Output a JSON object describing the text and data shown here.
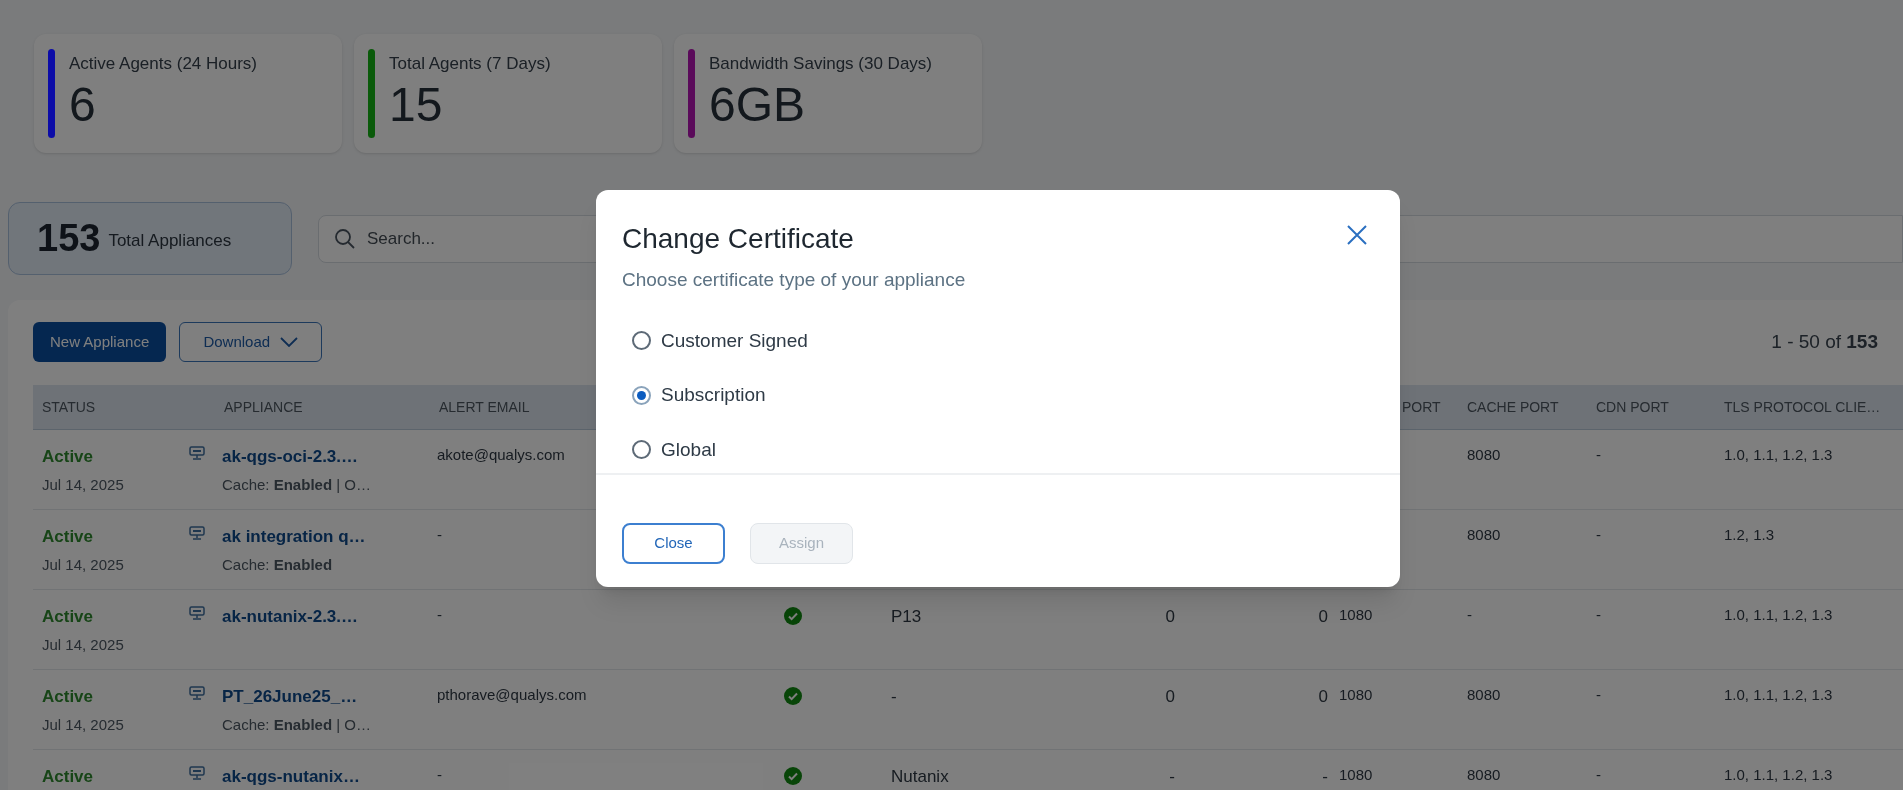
{
  "stats": [
    {
      "label": "Active Agents (24 Hours)",
      "value": "6",
      "color": "#0c0ca8"
    },
    {
      "label": "Total Agents (7 Days)",
      "value": "15",
      "color": "#0a5a0a"
    },
    {
      "label": "Bandwidth Savings (30 Days)",
      "value": "6GB",
      "color": "#5a0a5a"
    }
  ],
  "appliance_total": {
    "count": "153",
    "label": "Total Appliances"
  },
  "search": {
    "placeholder": "Search..."
  },
  "toolbar": {
    "buttons": [
      {
        "label": "New Appliance",
        "kind": "primary"
      },
      {
        "label": "Download",
        "kind": "dropdown"
      }
    ],
    "pagination": "1 - 50 of **153**"
  },
  "table": {
    "columns": {
      "status": "STATUS",
      "appliance": "APPLIANCE",
      "alert_email": "ALERT EMAIL",
      "column_9": "PORT",
      "cache_port": "CACHE PORT",
      "cdn_port": "CDN PORT",
      "tls_protocol": "TLS PROTOCOL CLIE…"
    },
    "rows": [
      {
        "status": "Active",
        "date": "Jul 14, 2025",
        "appliance": "ak-qgs-oci-2.3.…",
        "details": "Cache: **Enabled** | O…",
        "alert_email": "akote@qualys.com",
        "cache_port": "8080",
        "cdn_port": "-",
        "tls_protocol": "1.0, 1.1, 1.2, 1.3"
      },
      {
        "status": "Active",
        "date": "Jul 14, 2025",
        "appliance": "ak integration q…",
        "details": "Cache: **Enabled**",
        "alert_email": "-",
        "cache_port": "8080",
        "cdn_port": "-",
        "tls_protocol": "1.2, 1.3"
      },
      {
        "status": "Active",
        "date": "Jul 14, 2025",
        "appliance": "ak-nutanix-2.3.…",
        "alert_email": "-",
        "ok": true,
        "column_6": "P13",
        "column_7": "0",
        "column_8": "0",
        "column_9": "1080",
        "cache_port": "-",
        "cdn_port": "-",
        "tls_protocol": "1.0, 1.1, 1.2, 1.3"
      },
      {
        "status": "Active",
        "date": "Jul 14, 2025",
        "appliance": "PT_26June25_…",
        "details": "Cache: **Enabled** | O…",
        "alert_email": "pthorave@qualys.com",
        "ok": true,
        "column_6": "-",
        "column_7": "0",
        "column_8": "0",
        "column_9": "1080",
        "cache_port": "8080",
        "cdn_port": "-",
        "tls_protocol": "1.0, 1.1, 1.2, 1.3"
      },
      {
        "status": "Active",
        "appliance": "ak-qgs-nutanix…",
        "alert_email": "-",
        "ok": true,
        "column_6": "Nutanix",
        "column_7": "-",
        "column_8": "-",
        "column_9": "1080",
        "cache_port": "8080",
        "cdn_port": "-",
        "tls_protocol": "1.0, 1.1, 1.2, 1.3"
      }
    ]
  },
  "modal": {
    "title": "Change Certificate",
    "subtitle": "Choose certificate type of your appliance",
    "options": [
      {
        "label": "Customer Signed",
        "selected": false
      },
      {
        "label": "Subscription",
        "selected": true
      },
      {
        "label": "Global",
        "selected": false
      }
    ],
    "buttons": [
      {
        "label": "Close",
        "disabled": false
      },
      {
        "label": "Assign",
        "disabled": true
      }
    ]
  }
}
